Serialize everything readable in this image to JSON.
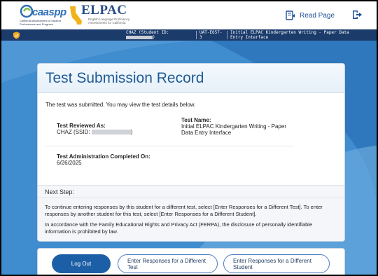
{
  "header": {
    "caaspp_logo_text": "caaspp",
    "caaspp_logo_subtitle": "California Assessment of Student Performance and Progress",
    "elpac_logo_text": "ELPAC",
    "elpac_logo_subtitle": "English Language Proficiency Assessments for California",
    "read_page_label": "Read Page"
  },
  "infobar": {
    "student_label": "CHAZ (Student ID:",
    "test_id": "UAT-E657-3",
    "test_name": "Initial ELPAC Kindergarten Writing - Paper Data Entry Interface"
  },
  "card": {
    "title": "Test Submission Record",
    "intro": "The test was submitted. You may view the test details below.",
    "reviewed_label": "Test Reviewed As:",
    "reviewed_value": "CHAZ (SSID:",
    "test_name_label": "Test Name:",
    "test_name_value": "Initial ELPAC Kindergarten Writing - Paper Data Entry Interface",
    "completed_label": "Test Administration Completed On:",
    "completed_value": "6/26/2025",
    "next_step_title": "Next Step:",
    "next_step_p1": "To continue entering responses by this student for a different test, select [Enter Responses for a Different Test]. To enter responses by another student for this test, select [Enter Responses for a Different Student].",
    "next_step_p2": "In accordance with the Family Educational Rights and Privacy Act (FERPA), the disclosure of personally identifiable information is prohibited by law."
  },
  "buttons": {
    "logout": "Log Out",
    "diff_test": "Enter Responses for a Different Test",
    "diff_student": "Enter Responses for a Different Student"
  },
  "colors": {
    "navy": "#1b3b6b",
    "brand_blue": "#1f5c96",
    "button_blue": "#1d5fa6",
    "background_blue": "#3f8ccf"
  }
}
